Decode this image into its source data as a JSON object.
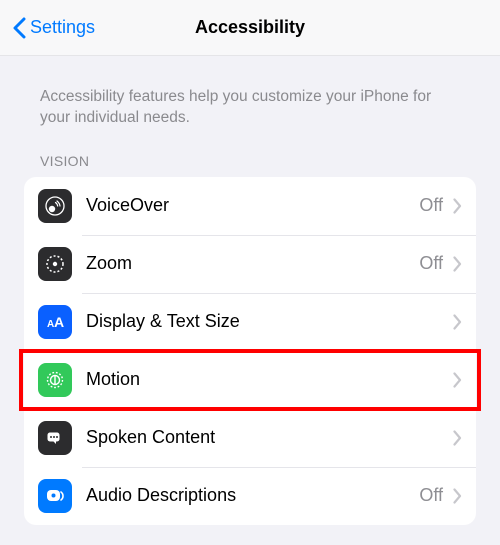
{
  "navbar": {
    "back_label": "Settings",
    "title": "Accessibility"
  },
  "description": "Accessibility features help you customize your iPhone for your individual needs.",
  "section_header": "VISION",
  "rows": [
    {
      "label": "VoiceOver",
      "status": "Off"
    },
    {
      "label": "Zoom",
      "status": "Off"
    },
    {
      "label": "Display & Text Size",
      "status": ""
    },
    {
      "label": "Motion",
      "status": ""
    },
    {
      "label": "Spoken Content",
      "status": ""
    },
    {
      "label": "Audio Descriptions",
      "status": "Off"
    }
  ],
  "highlight": {
    "row_index": 3
  }
}
